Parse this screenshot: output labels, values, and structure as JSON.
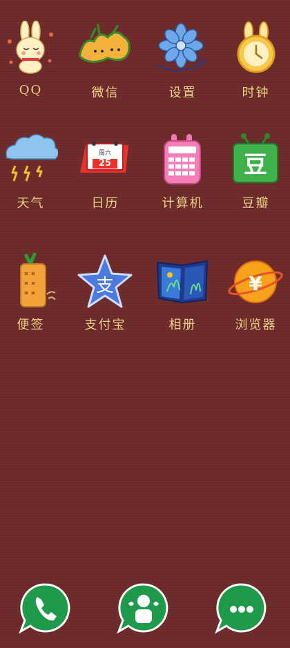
{
  "apps": [
    {
      "label": "QQ",
      "icon": "bunny-qq-icon"
    },
    {
      "label": "微信",
      "icon": "carrot-wechat-icon"
    },
    {
      "label": "设置",
      "icon": "snowflake-settings-icon"
    },
    {
      "label": "时钟",
      "icon": "bunny-clock-icon"
    },
    {
      "label": "天气",
      "icon": "storm-cloud-weather-icon"
    },
    {
      "label": "日历",
      "icon": "calendar-icon"
    },
    {
      "label": "计算机",
      "icon": "bunny-calculator-icon"
    },
    {
      "label": "豆瓣",
      "icon": "douban-icon"
    },
    {
      "label": "便签",
      "icon": "carrot-notes-icon"
    },
    {
      "label": "支付宝",
      "icon": "star-alipay-icon"
    },
    {
      "label": "相册",
      "icon": "photo-album-icon"
    },
    {
      "label": "浏览器",
      "icon": "planet-browser-icon"
    }
  ],
  "calendar_date": "25",
  "calendar_weekday": "周六",
  "alipay_glyph": "支",
  "douban_glyph": "豆",
  "dock": [
    {
      "icon": "phone-icon"
    },
    {
      "icon": "contacts-icon"
    },
    {
      "icon": "messages-icon"
    }
  ],
  "colors": {
    "background": "#6e2a2a",
    "label": "#f6d38a",
    "dock_green": "#1f9a4a"
  }
}
